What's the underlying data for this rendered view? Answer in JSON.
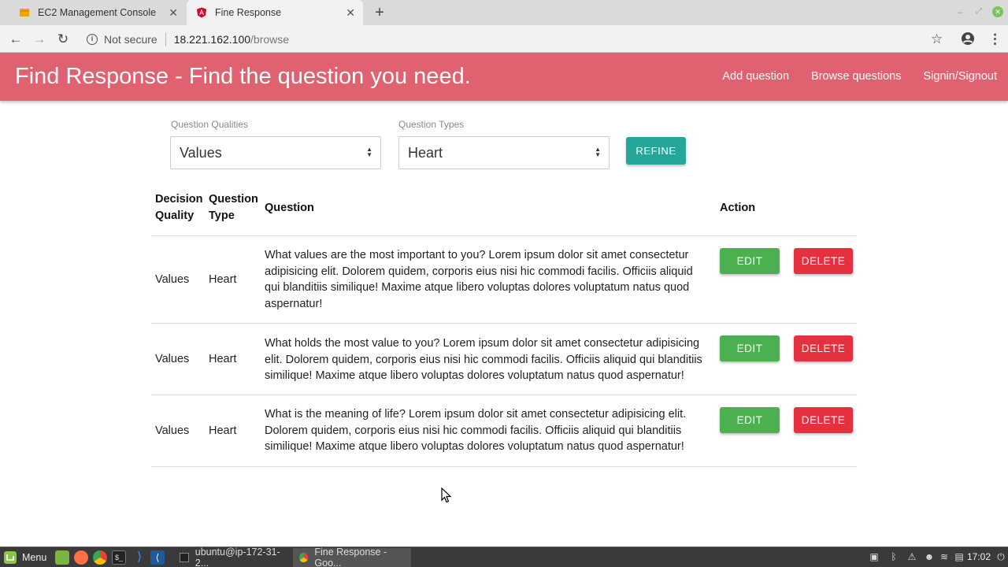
{
  "browser": {
    "tabs": [
      {
        "title": "EC2 Management Console",
        "active": false,
        "icon": "aws-cube-icon"
      },
      {
        "title": "Fine Response",
        "active": true,
        "icon": "angular-icon"
      }
    ],
    "security_text": "Not secure",
    "url_host": "18.221.162.100",
    "url_path": "/browse"
  },
  "app": {
    "brand": "Find Response - Find the question you need.",
    "nav": [
      "Add question",
      "Browse questions",
      "Signin/Signout"
    ],
    "accent_color": "#e06170"
  },
  "filters": {
    "qualities_label": "Question Qualities",
    "qualities_value": "Values",
    "types_label": "Question Types",
    "types_value": "Heart",
    "refine_label": "REFINE"
  },
  "table": {
    "headers": {
      "decision_quality_line1": "Decision",
      "decision_quality_line2": "Quality",
      "question_type_line1": "Question",
      "question_type_line2": "Type",
      "question": "Question",
      "action": "Action"
    },
    "rows": [
      {
        "quality": "Values",
        "type": "Heart",
        "question": "What values are the most important to you? Lorem ipsum dolor sit amet consectetur adipisicing elit. Dolorem quidem, corporis eius nisi hic commodi facilis. Officiis aliquid qui blanditiis similique! Maxime atque libero voluptas dolores voluptatum natus quod aspernatur!",
        "edit_label": "EDIT",
        "delete_label": "DELETE"
      },
      {
        "quality": "Values",
        "type": "Heart",
        "question": "What holds the most value to you? Lorem ipsum dolor sit amet consectetur adipisicing elit. Dolorem quidem, corporis eius nisi hic commodi facilis. Officiis aliquid qui blanditiis similique! Maxime atque libero voluptas dolores voluptatum natus quod aspernatur!",
        "edit_label": "EDIT",
        "delete_label": "DELETE"
      },
      {
        "quality": "Values",
        "type": "Heart",
        "question": "What is the meaning of life? Lorem ipsum dolor sit amet consectetur adipisicing elit. Dolorem quidem, corporis eius nisi hic commodi facilis. Officiis aliquid qui blanditiis similique! Maxime atque libero voluptas dolores voluptatum natus quod aspernatur!",
        "edit_label": "EDIT",
        "delete_label": "DELETE"
      }
    ]
  },
  "taskbar": {
    "menu_label": "Menu",
    "tasks": [
      "ubuntu@ip-172-31-2...",
      "Fine Response - Goo..."
    ],
    "clock": "17:02"
  }
}
